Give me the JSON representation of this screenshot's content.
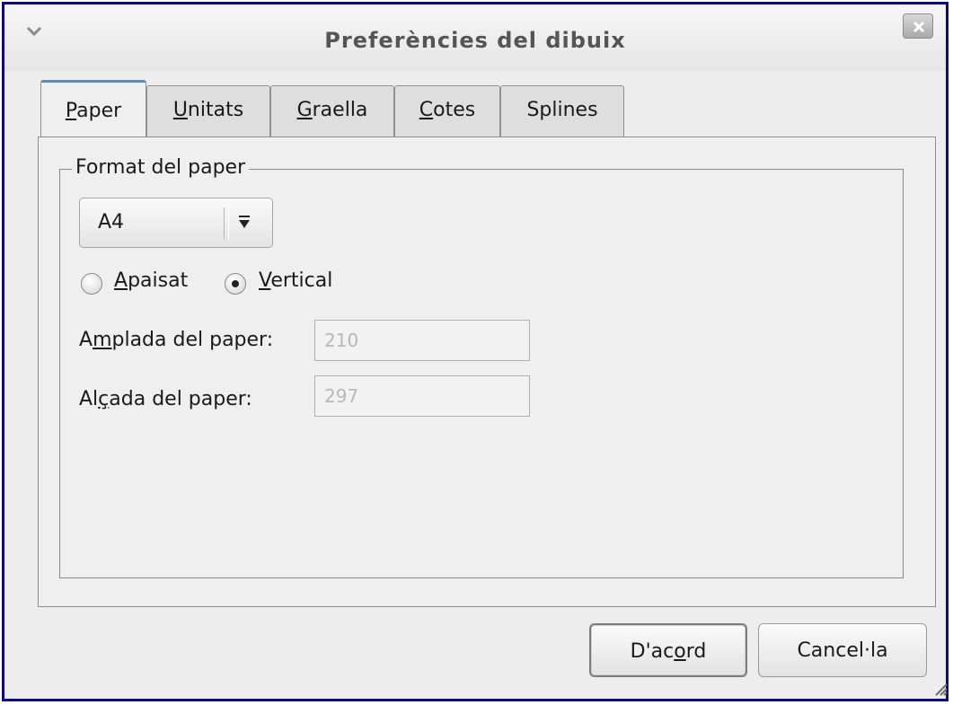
{
  "window": {
    "title": "Preferències del dibuix"
  },
  "tabs": [
    {
      "label": "Paper",
      "mnemonic": "P",
      "rest": "aper",
      "active": true
    },
    {
      "label": "Unitats",
      "mnemonic": "U",
      "rest": "nitats",
      "active": false
    },
    {
      "label": "Graella",
      "mnemonic": "G",
      "rest": "raella",
      "active": false
    },
    {
      "label": "Cotes",
      "mnemonic": "C",
      "rest": "otes",
      "active": false
    },
    {
      "label": "Splines",
      "mnemonic": "",
      "rest": "Splines",
      "active": false
    }
  ],
  "paper": {
    "frame_label": "Format del paper",
    "format": {
      "selected": "A4"
    },
    "orientation": {
      "landscape": {
        "mnemonic": "A",
        "rest": "paisat",
        "selected": false
      },
      "portrait": {
        "mnemonic": "V",
        "rest": "ertical",
        "selected": true
      }
    },
    "width": {
      "label_pre": "A",
      "label_mnemonic": "m",
      "label_post": "plada del paper:",
      "value": "210"
    },
    "height": {
      "label_pre": "Al",
      "label_mnemonic": "ç",
      "label_post": "ada del paper:",
      "value": "297"
    }
  },
  "buttons": {
    "ok": {
      "pre": "D'ac",
      "mnemonic": "o",
      "post": "rd"
    },
    "cancel": {
      "label": "Cancel·la"
    }
  },
  "icons": {
    "window_menu": "chevron-down-icon",
    "close": "close-icon",
    "combo": "dropdown-arrow-icon",
    "grip": "resize-grip-icon"
  }
}
